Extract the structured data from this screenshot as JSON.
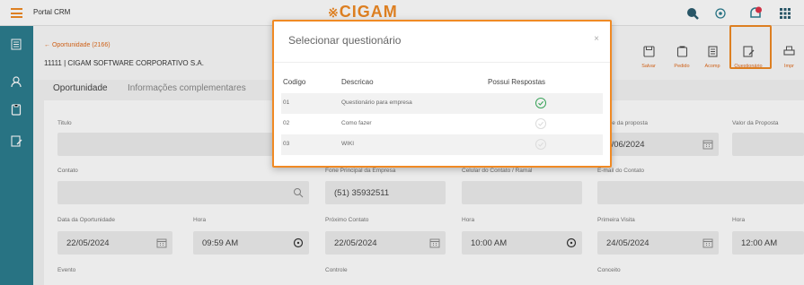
{
  "topbar": {
    "title": "Portal CRM",
    "logo": "CIGAM",
    "icons": [
      "search-icon",
      "settings-icon",
      "notifications-icon",
      "apps-icon"
    ]
  },
  "sidebar": {
    "icons": [
      "list-icon",
      "user-icon",
      "document-icon",
      "edit-icon"
    ]
  },
  "header": {
    "back_link": "Oportunidade (2166)",
    "company": "11111 | CIGAM SOFTWARE CORPORATIVO S.A."
  },
  "toolbar": {
    "buttons": [
      {
        "label": "Salvar",
        "icon": "save-icon"
      },
      {
        "label": "Pedido",
        "icon": "order-icon"
      },
      {
        "label": "Acomp",
        "icon": "follow-icon"
      },
      {
        "label": "Questionário",
        "icon": "questionnaire-icon"
      },
      {
        "label": "Impr",
        "icon": "print-icon"
      }
    ]
  },
  "tabs": [
    {
      "label": "Oportunidade",
      "active": true
    },
    {
      "label": "Informações complementares",
      "active": false
    }
  ],
  "form": {
    "titulo_label": "Titulo",
    "validade_label": "Validade da proposta",
    "validade_value": "21/06/2024",
    "valor_label": "Valor da Proposta",
    "contato_label": "Contato",
    "fone_label": "Fone Principal da Empresa",
    "fone_value": "(51) 35932511",
    "celular_label": "Celular do Contato / Ramal",
    "email_label": "E-mail do Contato",
    "data_op_label": "Data da Oportunidade",
    "data_op_value": "22/05/2024",
    "hora1_label": "Hora",
    "hora1_value": "09:59 AM",
    "prox_label": "Próximo Contato",
    "prox_value": "22/05/2024",
    "hora2_label": "Hora",
    "hora2_value": "10:00 AM",
    "primeira_label": "Primeira Visita",
    "primeira_value": "24/05/2024",
    "hora3_label": "Hora",
    "hora3_value": "12:00 AM",
    "evento_label": "Evento",
    "controle_label": "Controle",
    "conceito_label": "Conceito"
  },
  "modal": {
    "title": "Selecionar questionário",
    "close": "×",
    "headers": [
      "Codigo",
      "Descricao",
      "Possui Respostas"
    ],
    "rows": [
      {
        "codigo": "01",
        "descricao": "Questionário para empresa",
        "possui_respostas": true
      },
      {
        "codigo": "02",
        "descricao": "Como fazer",
        "possui_respostas": false
      },
      {
        "codigo": "03",
        "descricao": "WIKI",
        "possui_respostas": false
      }
    ]
  },
  "colors": {
    "accent": "#f08a24",
    "sidebar": "#2c7d8f",
    "check_active": "#3aa35a"
  }
}
